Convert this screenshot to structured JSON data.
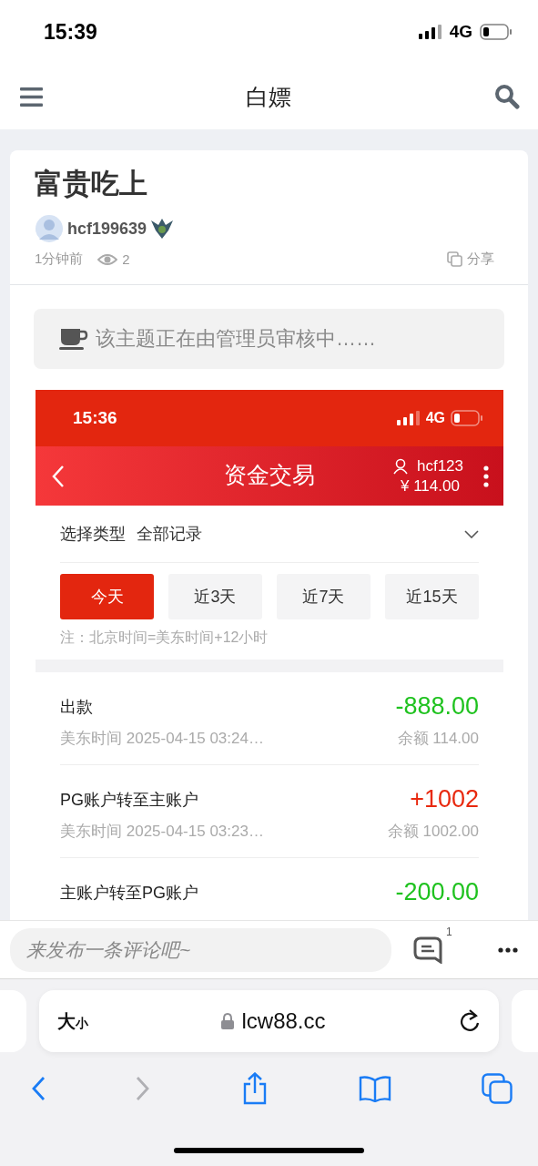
{
  "status_bar": {
    "time": "15:39",
    "network": "4G"
  },
  "nav": {
    "title": "白嫖"
  },
  "post": {
    "title": "富贵吃上",
    "author": "hcf199639",
    "time": "1分钟前",
    "views": "2",
    "share": "分享",
    "notice": "该主题正在由管理员审核中……"
  },
  "screenshot": {
    "status_bar": {
      "time": "15:36",
      "network": "4G"
    },
    "title": "资金交易",
    "username": "hcf123",
    "balance": "¥ 114.00",
    "filter": {
      "label": "选择类型",
      "value": "全部记录"
    },
    "periods": [
      {
        "label": "今天",
        "selected": true
      },
      {
        "label": "近3天",
        "selected": false
      },
      {
        "label": "近7天",
        "selected": false
      },
      {
        "label": "近15天",
        "selected": false
      }
    ],
    "note": "注：北京时间=美东时间+12小时",
    "records": [
      {
        "name": "出款",
        "kind": "debit",
        "amount": "-888.00",
        "time": "美东时间 2025-04-15 03:24…",
        "balance": "余额 114.00"
      },
      {
        "name": "PG账户转至主账户",
        "kind": "credit",
        "amount": "+1002",
        "time": "美东时间 2025-04-15 03:23…",
        "balance": "余额 1002.00"
      },
      {
        "name": "主账户转至PG账户",
        "kind": "debit",
        "amount": "-200.00"
      }
    ]
  },
  "comment_bar": {
    "placeholder": "来发布一条评论吧~",
    "comment_count": "1"
  },
  "browser": {
    "text_size": "大$_{小}$",
    "url": "lcw88.cc"
  }
}
